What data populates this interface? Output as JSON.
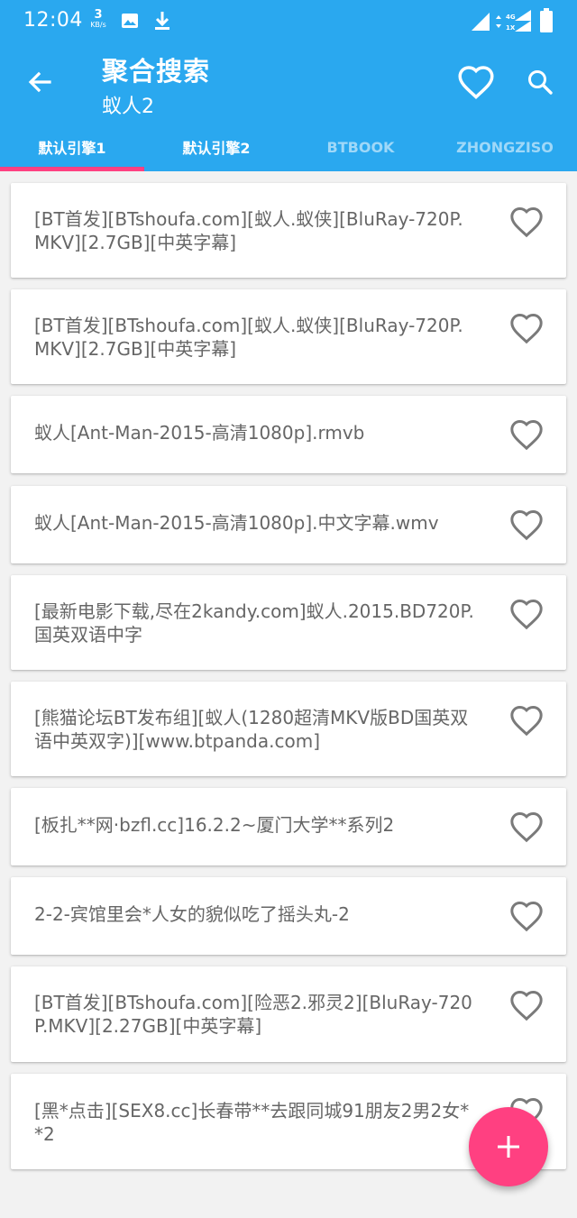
{
  "status_bar": {
    "time": "12:04",
    "net_speed_value": "3",
    "net_speed_unit": "KB/s",
    "icons": [
      "image-icon",
      "download-icon",
      "signal-icon",
      "mobile-data-icon",
      "battery-icon"
    ],
    "network_labels": [
      "4G",
      "1X"
    ]
  },
  "toolbar": {
    "title": "聚合搜索",
    "subtitle": "蚁人2",
    "icons": [
      "back-arrow-icon",
      "heart-outline-icon",
      "search-icon"
    ]
  },
  "tabs": [
    {
      "label": "默认引擎1",
      "selected": true
    },
    {
      "label": "默认引擎2",
      "selected": false
    },
    {
      "label": "BTBOOK",
      "selected": false
    },
    {
      "label": "ZHONGZISO",
      "selected": false
    }
  ],
  "results": [
    {
      "title": "[BT首发][BTshoufa.com][蚁人.蚁侠][BluRay-720P.MKV][2.7GB][中英字幕]"
    },
    {
      "title": "[BT首发][BTshoufa.com][蚁人.蚁侠][BluRay-720P.MKV][2.7GB][中英字幕]"
    },
    {
      "title": "蚁人[Ant-Man-2015-高清1080p].rmvb"
    },
    {
      "title": "蚁人[Ant-Man-2015-高清1080p].中文字幕.wmv"
    },
    {
      "title": "[最新电影下载,尽在2kandy.com]蚁人.2015.BD720P.国英双语中字"
    },
    {
      "title": "[熊猫论坛BT发布组][蚁人(1280超清MKV版BD国英双语中英双字)][www.btpanda.com]"
    },
    {
      "title": "[板扎**网·bzfl.cc]16.2.2~厦门大学**系列2"
    },
    {
      "title": "2-2-宾馆里会*人女的貌似吃了摇头丸-2"
    },
    {
      "title": "[BT首发][BTshoufa.com][险恶2.邪灵2][BluRay-720P.MKV][2.27GB][中英字幕]"
    },
    {
      "title": "[黑*点击][SEX8.cc]长春带**去跟同城91朋友2男2女**2"
    }
  ],
  "fab": {
    "icon": "plus-icon"
  },
  "colors": {
    "primary": "#2aa8ef",
    "accent": "#ff4081",
    "background": "#f2f2f2",
    "card_text": "#666666",
    "icon_gray": "#7a7a7a"
  }
}
